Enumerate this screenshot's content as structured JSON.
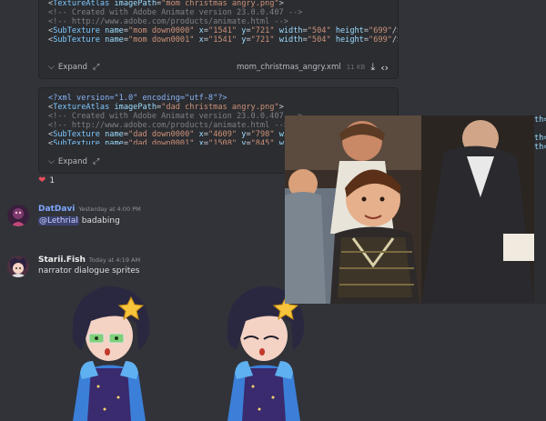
{
  "code_blocks": [
    {
      "lines": [
        {
          "parts": [
            [
              "c-pun",
              "<"
            ],
            [
              "c-tag",
              "TextureAtlas"
            ],
            [
              "c-pun",
              " "
            ],
            [
              "c-attr",
              "imagePath"
            ],
            [
              "c-pun",
              "="
            ],
            [
              "c-str",
              "\"mom christmas angry.png\""
            ],
            [
              "c-pun",
              ">"
            ]
          ]
        },
        {
          "parts": [
            [
              "c-com",
              "<!-- Created with Adobe Animate version 23.0.0.407 -->"
            ]
          ]
        },
        {
          "parts": [
            [
              "c-com",
              "<!-- http://www.adobe.com/products/animate.html -->"
            ]
          ]
        },
        {
          "parts": [
            [
              "c-pun",
              "<"
            ],
            [
              "c-tag",
              "SubTexture"
            ],
            [
              "c-pun",
              " "
            ],
            [
              "c-attr",
              "name"
            ],
            [
              "c-pun",
              "="
            ],
            [
              "c-str",
              "\"mom down0000\""
            ],
            [
              "c-pun",
              " "
            ],
            [
              "c-attr",
              "x"
            ],
            [
              "c-pun",
              "="
            ],
            [
              "c-str",
              "\"1541\""
            ],
            [
              "c-pun",
              " "
            ],
            [
              "c-attr",
              "y"
            ],
            [
              "c-pun",
              "="
            ],
            [
              "c-str",
              "\"721\""
            ],
            [
              "c-pun",
              " "
            ],
            [
              "c-attr",
              "width"
            ],
            [
              "c-pun",
              "="
            ],
            [
              "c-str",
              "\"504\""
            ],
            [
              "c-pun",
              " "
            ],
            [
              "c-attr",
              "height"
            ],
            [
              "c-pun",
              "="
            ],
            [
              "c-str",
              "\"699\""
            ],
            [
              "c-pun",
              "/>"
            ]
          ]
        },
        {
          "parts": [
            [
              "c-pun",
              "<"
            ],
            [
              "c-tag",
              "SubTexture"
            ],
            [
              "c-pun",
              " "
            ],
            [
              "c-attr",
              "name"
            ],
            [
              "c-pun",
              "="
            ],
            [
              "c-str",
              "\"mom down0001\""
            ],
            [
              "c-pun",
              " "
            ],
            [
              "c-attr",
              "x"
            ],
            [
              "c-pun",
              "="
            ],
            [
              "c-str",
              "\"1541\""
            ],
            [
              "c-pun",
              " "
            ],
            [
              "c-attr",
              "y"
            ],
            [
              "c-pun",
              "="
            ],
            [
              "c-str",
              "\"721\""
            ],
            [
              "c-pun",
              " "
            ],
            [
              "c-attr",
              "width"
            ],
            [
              "c-pun",
              "="
            ],
            [
              "c-str",
              "\"504\""
            ],
            [
              "c-pun",
              " "
            ],
            [
              "c-attr",
              "height"
            ],
            [
              "c-pun",
              "="
            ],
            [
              "c-str",
              "\"699\""
            ],
            [
              "c-pun",
              "/>"
            ]
          ]
        }
      ],
      "expand_label": "Expand",
      "filename": "mom_christmas_angry.xml",
      "filesize": "11 KB"
    },
    {
      "lines": [
        {
          "parts": [
            [
              "c-pi",
              "<?xml version=\"1.0\" encoding=\"utf-8\"?>"
            ]
          ]
        },
        {
          "parts": [
            [
              "c-pun",
              "<"
            ],
            [
              "c-tag",
              "TextureAtlas"
            ],
            [
              "c-pun",
              " "
            ],
            [
              "c-attr",
              "imagePath"
            ],
            [
              "c-pun",
              "="
            ],
            [
              "c-str",
              "\"dad christmas angry.png\""
            ],
            [
              "c-pun",
              ">"
            ]
          ]
        },
        {
          "parts": [
            [
              "c-com",
              "<!-- Created with Adobe Animate version 23.0.0.407 -->"
            ]
          ]
        },
        {
          "parts": [
            [
              "c-com",
              "<!-- http://www.adobe.com/products/animate.html -->"
            ]
          ]
        },
        {
          "parts": [
            [
              "c-pun",
              "<"
            ],
            [
              "c-tag",
              "SubTexture"
            ],
            [
              "c-pun",
              " "
            ],
            [
              "c-attr",
              "name"
            ],
            [
              "c-pun",
              "="
            ],
            [
              "c-str",
              "\"dad down0000\""
            ],
            [
              "c-pun",
              " "
            ],
            [
              "c-attr",
              "x"
            ],
            [
              "c-pun",
              "="
            ],
            [
              "c-str",
              "\"4609\""
            ],
            [
              "c-pun",
              " "
            ],
            [
              "c-attr",
              "y"
            ],
            [
              "c-pun",
              "="
            ],
            [
              "c-str",
              "\"798\""
            ],
            [
              "c-pun",
              " "
            ],
            [
              "c-attr",
              "wid"
            ]
          ]
        },
        {
          "parts": [
            [
              "c-pun",
              "<"
            ],
            [
              "c-tag",
              "SubTexture"
            ],
            [
              "c-pun",
              " "
            ],
            [
              "c-attr",
              "name"
            ],
            [
              "c-pun",
              "="
            ],
            [
              "c-str",
              "\"dad down0001\""
            ],
            [
              "c-pun",
              " "
            ],
            [
              "c-attr",
              "x"
            ],
            [
              "c-pun",
              "="
            ],
            [
              "c-str",
              "\"1508\""
            ],
            [
              "c-pun",
              " "
            ],
            [
              "c-attr",
              "y"
            ],
            [
              "c-pun",
              "="
            ],
            [
              "c-str",
              "\"845\""
            ],
            [
              "c-pun",
              " "
            ],
            [
              "c-attr",
              "wid"
            ]
          ]
        }
      ],
      "expand_label": "Expand"
    }
  ],
  "video_edge_text": "th=\n\nth=\nth=",
  "reaction": {
    "emoji": "❤",
    "count": "1"
  },
  "messages": [
    {
      "username": "DatDavi",
      "username_color": "#7ea7ff",
      "timestamp": "Yesterday at 4:00 PM",
      "mention": "@Lethrial",
      "text": " badabing"
    },
    {
      "username": "Starii.Fish",
      "username_color": "#f0f0f0",
      "timestamp": "Today at 4:19 AM",
      "text": "narrator dialogue sprites"
    }
  ],
  "icons": {
    "expand_chevron": "chevron-down-icon",
    "expand_arrows": "expand-arrows-icon",
    "download": "download-icon",
    "code": "code-icon",
    "reaction": "heart-icon"
  }
}
